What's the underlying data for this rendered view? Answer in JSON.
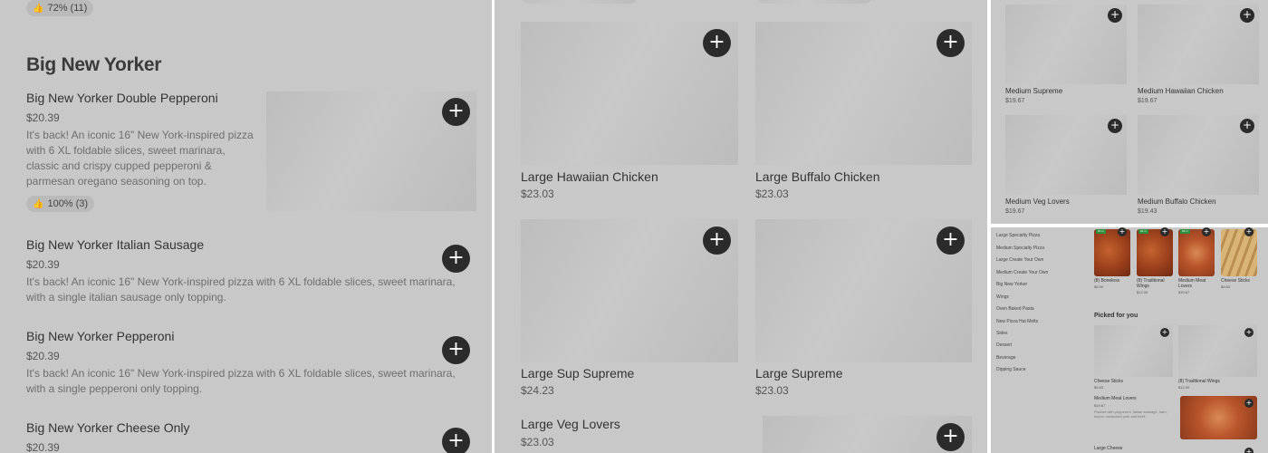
{
  "panel1": {
    "top_badge": {
      "icon": "thumbs-up-icon",
      "text": "72% (11)"
    },
    "section_title": "Big New Yorker",
    "items": [
      {
        "name": "Big New Yorker Double Pepperoni",
        "price": "$20.39",
        "description": "It's back! An iconic 16\" New York-inspired pizza with 6 XL foldable slices, sweet marinara, classic and crispy cupped pepperoni & parmesan oregano seasoning on top.",
        "badge": "100% (3)"
      },
      {
        "name": "Big New Yorker Italian Sausage",
        "price": "$20.39",
        "description": "It's back! An iconic 16\" New York-inspired pizza with 6 XL foldable slices, sweet marinara, with a single italian sausage only topping."
      },
      {
        "name": "Big New Yorker Pepperoni",
        "price": "$20.39",
        "description": "It's back! An iconic 16\" New York-inspired pizza with 6 XL foldable slices, sweet marinara, with a single pepperoni only topping."
      },
      {
        "name": "Big New Yorker Cheese Only",
        "price": "$20.39"
      }
    ],
    "add_symbol": "+"
  },
  "panel2": {
    "items": [
      {
        "name": "Large Hawaiian Chicken",
        "price": "$23.03"
      },
      {
        "name": "Large Buffalo Chicken",
        "price": "$23.03"
      },
      {
        "name": "Large Sup Supreme",
        "price": "$24.23"
      },
      {
        "name": "Large Supreme",
        "price": "$23.03"
      },
      {
        "name": "Large Veg Lovers",
        "price": "$23.03"
      }
    ]
  },
  "panel3": {
    "items": [
      {
        "name": "Medium Supreme",
        "price": "$19.67"
      },
      {
        "name": "Medium Hawaiian Chicken",
        "price": "$19.67"
      },
      {
        "name": "Medium Veg Lovers",
        "price": "$19.67"
      },
      {
        "name": "Medium Buffalo Chicken",
        "price": "$19.43"
      }
    ]
  },
  "panel4": {
    "nav": [
      "Large Specialty Pizza",
      "Medium Specialty Pizza",
      "Large Create Your Own",
      "Medium Create Your Own",
      "Big New Yorker",
      "Wings",
      "Oven Baked Pasta",
      "New Pizza Hut Melts",
      "Sides",
      "Dessert",
      "Beverage",
      "Dipping Sauce"
    ],
    "top_row": [
      {
        "name": "(8) Boneless",
        "price": "$9.99",
        "tag": "#1 m"
      },
      {
        "name": "(8) Traditional Wings",
        "price": "$12.00",
        "tag": "#2 m"
      },
      {
        "name": "Medium Meat Lovers",
        "price": "$19.67",
        "tag": "#3 m"
      },
      {
        "name": "Cheese Sticks",
        "price": "$9.83"
      }
    ],
    "picked_title": "Picked for you",
    "picked": [
      {
        "name": "Cheese Sticks",
        "price": "$9.83"
      },
      {
        "name": "(8) Traditional Wings",
        "price": "$12.00"
      }
    ],
    "featured": {
      "name": "Medium Meat Lovers",
      "price": "$19.67",
      "description": "Packed with pepperoni, Italian sausage, ham, bacon, seasoned pork and beef."
    },
    "bottom_label": "Large Cheese"
  }
}
